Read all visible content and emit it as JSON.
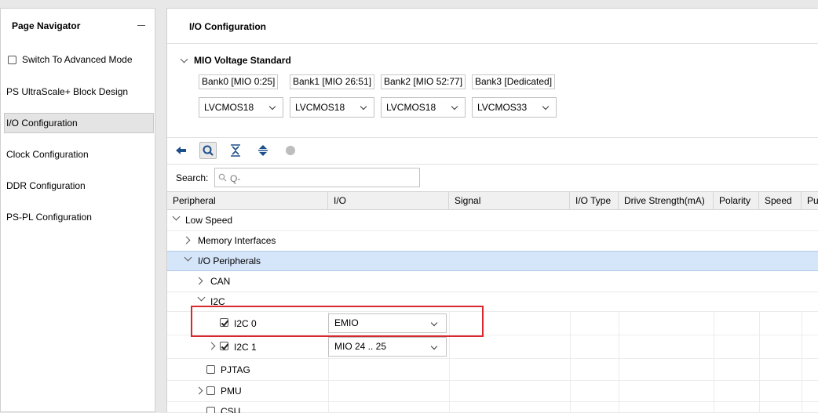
{
  "navigator": {
    "title": "Page Navigator",
    "advanced_mode_label": "Switch To Advanced Mode",
    "advanced_mode_checked": false,
    "items": [
      {
        "label": "PS UltraScale+ Block Design"
      },
      {
        "label": "I/O Configuration",
        "selected": true
      },
      {
        "label": "Clock Configuration"
      },
      {
        "label": "DDR Configuration"
      },
      {
        "label": "PS-PL Configuration"
      }
    ]
  },
  "main": {
    "title": "I/O Configuration",
    "mio_voltage": {
      "title": "MIO Voltage Standard",
      "banks": [
        {
          "label": "Bank0 [MIO 0:25]",
          "value": "LVCMOS18"
        },
        {
          "label": "Bank1 [MIO 26:51]",
          "value": "LVCMOS18"
        },
        {
          "label": "Bank2 [MIO 52:77]",
          "value": "LVCMOS18"
        },
        {
          "label": "Bank3 [Dedicated]",
          "value": "LVCMOS33"
        }
      ]
    },
    "search": {
      "label": "Search:",
      "placeholder": "Q-"
    },
    "columns": [
      "Peripheral",
      "I/O",
      "Signal",
      "I/O Type",
      "Drive Strength(mA)",
      "Polarity",
      "Speed",
      "Pu"
    ],
    "rows": [
      {
        "label": "Low Speed"
      },
      {
        "label": "Memory Interfaces"
      },
      {
        "label": "I/O Peripherals"
      },
      {
        "label": "CAN"
      },
      {
        "label": "I2C"
      },
      {
        "label": "I2C 0",
        "checked": true,
        "io": "EMIO"
      },
      {
        "label": "I2C 1",
        "checked": true,
        "io": "MIO 24 .. 25"
      },
      {
        "label": "PJTAG",
        "checked": false
      },
      {
        "label": "PMU",
        "checked": false
      },
      {
        "label": "CSU",
        "checked": false
      }
    ]
  },
  "colors": {
    "selection": "#d6e6fa",
    "highlight_box": "#d9272e",
    "accent_icon": "#1e4f8a"
  }
}
